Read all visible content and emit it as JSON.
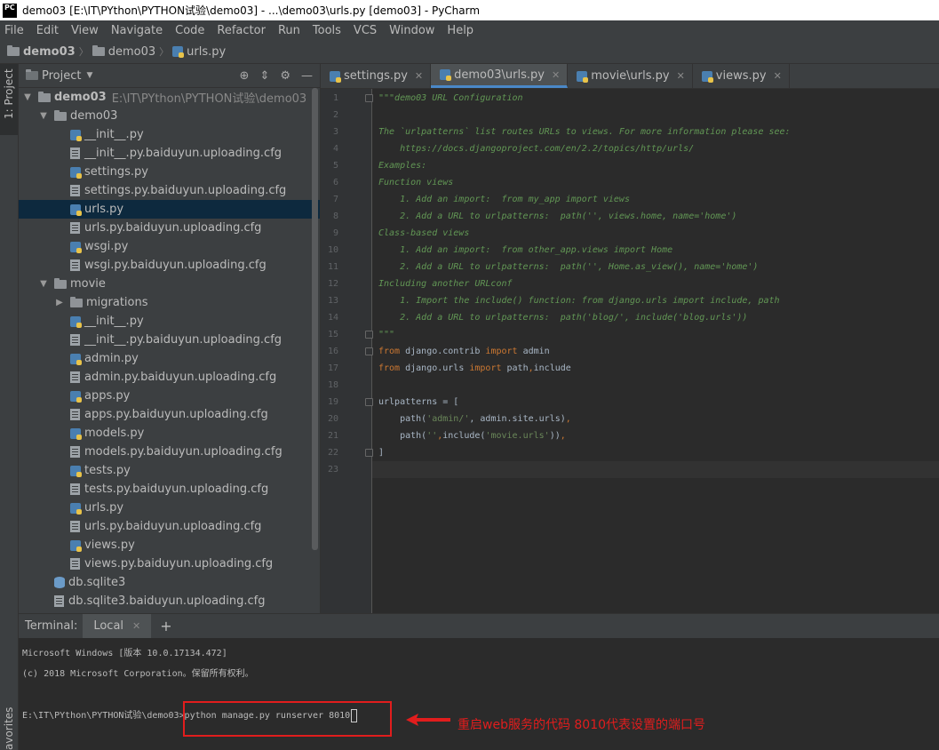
{
  "window": {
    "title": "demo03 [E:\\IT\\PYthon\\PYTHON试验\\demo03] - ...\\demo03\\urls.py [demo03] - PyCharm",
    "app_icon": "PC"
  },
  "menu": [
    "File",
    "Edit",
    "View",
    "Navigate",
    "Code",
    "Refactor",
    "Run",
    "Tools",
    "VCS",
    "Window",
    "Help"
  ],
  "breadcrumb": [
    "demo03",
    "demo03",
    "urls.py"
  ],
  "left_strip": {
    "project_tab": "1: Project",
    "favorites_tab": "avorites"
  },
  "project_panel": {
    "title": "Project",
    "tree": [
      {
        "label": "demo03",
        "path": "E:\\IT\\PYthon\\PYTHON试验\\demo03",
        "icon": "folder",
        "indent": 0,
        "arrow": "▼",
        "bold": true
      },
      {
        "label": "demo03",
        "icon": "folder",
        "indent": 1,
        "arrow": "▼"
      },
      {
        "label": "__init__.py",
        "icon": "python-file",
        "indent": 2
      },
      {
        "label": "__init__.py.baiduyun.uploading.cfg",
        "icon": "config-file",
        "indent": 2
      },
      {
        "label": "settings.py",
        "icon": "python-file",
        "indent": 2
      },
      {
        "label": "settings.py.baiduyun.uploading.cfg",
        "icon": "config-file",
        "indent": 2
      },
      {
        "label": "urls.py",
        "icon": "python-file",
        "indent": 2,
        "selected": true
      },
      {
        "label": "urls.py.baiduyun.uploading.cfg",
        "icon": "config-file",
        "indent": 2
      },
      {
        "label": "wsgi.py",
        "icon": "python-file",
        "indent": 2
      },
      {
        "label": "wsgi.py.baiduyun.uploading.cfg",
        "icon": "config-file",
        "indent": 2
      },
      {
        "label": "movie",
        "icon": "folder",
        "indent": 1,
        "arrow": "▼"
      },
      {
        "label": "migrations",
        "icon": "folder",
        "indent": 2,
        "arrow": "▶"
      },
      {
        "label": "__init__.py",
        "icon": "python-file",
        "indent": 2
      },
      {
        "label": "__init__.py.baiduyun.uploading.cfg",
        "icon": "config-file",
        "indent": 2
      },
      {
        "label": "admin.py",
        "icon": "python-file",
        "indent": 2
      },
      {
        "label": "admin.py.baiduyun.uploading.cfg",
        "icon": "config-file",
        "indent": 2
      },
      {
        "label": "apps.py",
        "icon": "python-file",
        "indent": 2
      },
      {
        "label": "apps.py.baiduyun.uploading.cfg",
        "icon": "config-file",
        "indent": 2
      },
      {
        "label": "models.py",
        "icon": "python-file",
        "indent": 2
      },
      {
        "label": "models.py.baiduyun.uploading.cfg",
        "icon": "config-file",
        "indent": 2
      },
      {
        "label": "tests.py",
        "icon": "python-file",
        "indent": 2
      },
      {
        "label": "tests.py.baiduyun.uploading.cfg",
        "icon": "config-file",
        "indent": 2
      },
      {
        "label": "urls.py",
        "icon": "python-file",
        "indent": 2
      },
      {
        "label": "urls.py.baiduyun.uploading.cfg",
        "icon": "config-file",
        "indent": 2
      },
      {
        "label": "views.py",
        "icon": "python-file",
        "indent": 2
      },
      {
        "label": "views.py.baiduyun.uploading.cfg",
        "icon": "config-file",
        "indent": 2
      },
      {
        "label": "db.sqlite3",
        "icon": "database-file",
        "indent": 1
      },
      {
        "label": "db.sqlite3.baiduyun.uploading.cfg",
        "icon": "config-file",
        "indent": 1
      }
    ]
  },
  "editor": {
    "tabs": [
      {
        "label": "settings.py",
        "active": false
      },
      {
        "label": "demo03\\urls.py",
        "active": true
      },
      {
        "label": "movie\\urls.py",
        "active": false
      },
      {
        "label": "views.py",
        "active": false
      }
    ],
    "lines": [
      [
        {
          "t": "\"\"\"demo03 URL Configuration",
          "c": "doc"
        }
      ],
      [],
      [
        {
          "t": "The `urlpatterns` list routes URLs to views. For more information please see:",
          "c": "doc"
        }
      ],
      [
        {
          "t": "    https://docs.djangoproject.com/en/2.2/topics/http/urls/",
          "c": "doc"
        }
      ],
      [
        {
          "t": "Examples:",
          "c": "doc"
        }
      ],
      [
        {
          "t": "Function views",
          "c": "doc"
        }
      ],
      [
        {
          "t": "    1. Add an import:  from my_app import views",
          "c": "doc"
        }
      ],
      [
        {
          "t": "    2. Add a URL to urlpatterns:  path('', views.home, name='home')",
          "c": "doc"
        }
      ],
      [
        {
          "t": "Class-based views",
          "c": "doc"
        }
      ],
      [
        {
          "t": "    1. Add an import:  from other_app.views import Home",
          "c": "doc"
        }
      ],
      [
        {
          "t": "    2. Add a URL to urlpatterns:  path('', Home.as_view(), name='home')",
          "c": "doc"
        }
      ],
      [
        {
          "t": "Including another URLconf",
          "c": "doc"
        }
      ],
      [
        {
          "t": "    1. Import the include() function: from django.urls import include, path",
          "c": "doc"
        }
      ],
      [
        {
          "t": "    2. Add a URL to urlpatterns:  path('blog/', include('blog.urls'))",
          "c": "doc"
        }
      ],
      [
        {
          "t": "\"\"\"",
          "c": "doc"
        }
      ],
      [
        {
          "t": "from",
          "c": "kw"
        },
        {
          "t": " django.contrib "
        },
        {
          "t": "import",
          "c": "kw"
        },
        {
          "t": " admin"
        }
      ],
      [
        {
          "t": "from",
          "c": "kw"
        },
        {
          "t": " django.urls "
        },
        {
          "t": "import",
          "c": "kw"
        },
        {
          "t": " path"
        },
        {
          "t": ",",
          "c": "kw"
        },
        {
          "t": "include"
        }
      ],
      [],
      [
        {
          "t": "urlpatterns = ["
        }
      ],
      [
        {
          "t": "    path("
        },
        {
          "t": "'admin/'",
          "c": "str"
        },
        {
          "t": ", admin.site.urls)"
        },
        {
          "t": ",",
          "c": "kw"
        }
      ],
      [
        {
          "t": "    path("
        },
        {
          "t": "''",
          "c": "str"
        },
        {
          "t": ",",
          "c": "kw"
        },
        {
          "t": "include("
        },
        {
          "t": "'movie.urls'",
          "c": "str"
        },
        {
          "t": "))"
        },
        {
          "t": ",",
          "c": "kw"
        }
      ],
      [
        {
          "t": "]"
        }
      ],
      []
    ]
  },
  "terminal": {
    "label": "Terminal:",
    "tab": "Local",
    "lines": [
      "Microsoft Windows [版本 10.0.17134.472]",
      "(c) 2018 Microsoft Corporation。保留所有权利。",
      "",
      "E:\\IT\\PYthon\\PYTHON试验\\demo03>python manage.py runserver 8010"
    ],
    "annotation": "重启web服务的代码    8010代表设置的端口号",
    "annotation_color": "#e11d1d"
  }
}
